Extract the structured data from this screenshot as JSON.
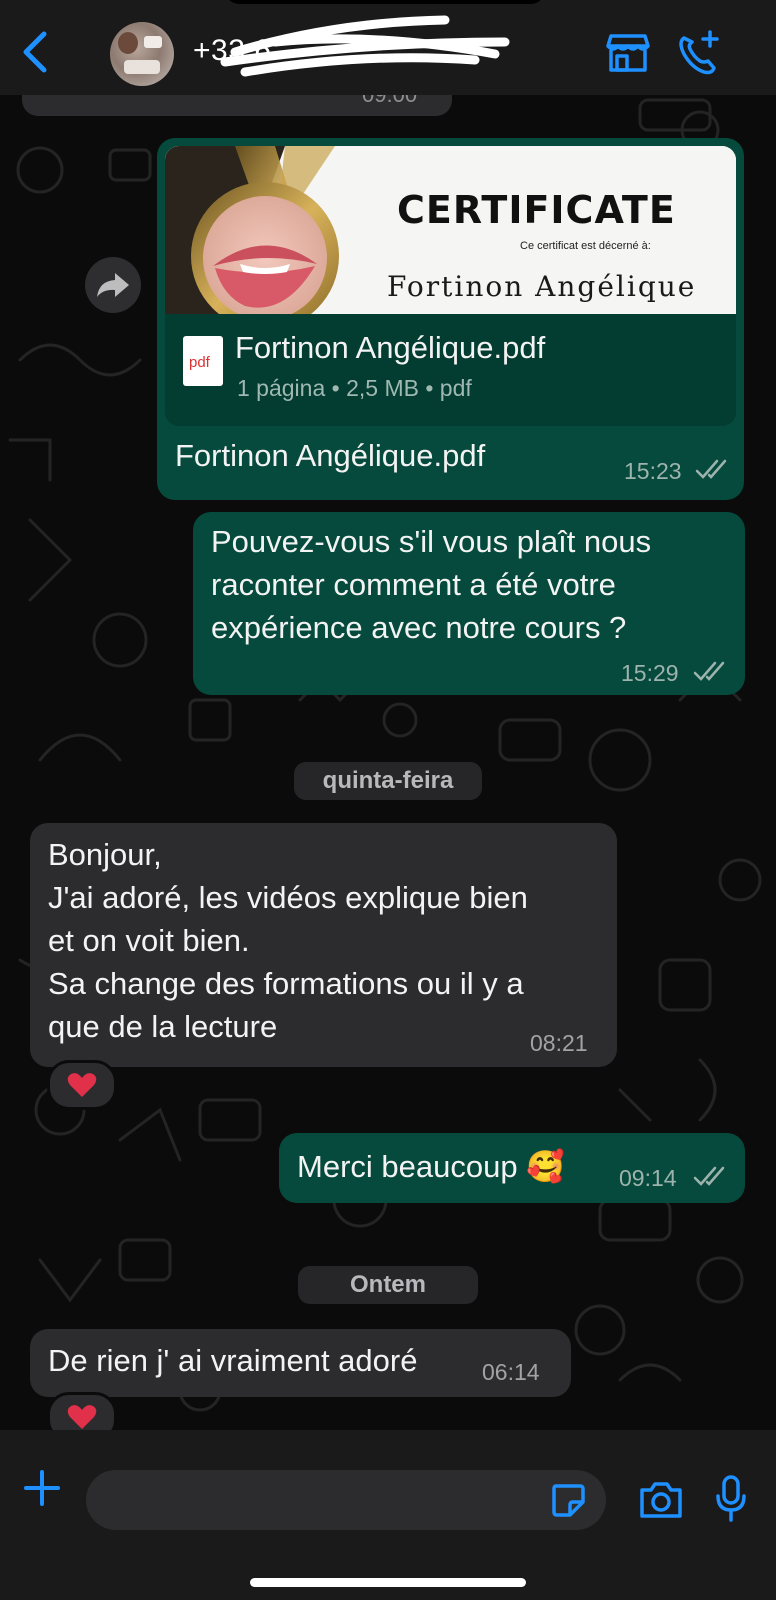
{
  "header": {
    "contact_name": "+33 6",
    "back_icon": "chevron-left-icon",
    "store_icon": "storefront-icon",
    "call_icon": "phone-plus-icon",
    "accent_color": "#1e90ff"
  },
  "top_partial_message": {
    "time": "09:00"
  },
  "file_message": {
    "preview": {
      "title": "CERTIFICATE",
      "subtitle": "Ce certificat est décerné à:",
      "recipient": "Fortinon Angélique"
    },
    "file_name": "Fortinon Angélique.pdf",
    "file_meta": "1 página • 2,5 MB • pdf",
    "file_type_label": "pdf",
    "caption": "Fortinon Angélique.pdf",
    "time": "15:23",
    "status": "read"
  },
  "question_message": {
    "lines": [
      "Pouvez-vous s'il vous plaît nous",
      "raconter comment a été votre",
      "expérience avec notre cours ?"
    ],
    "time": "15:29",
    "status": "read"
  },
  "date_separator_1": "quinta-feira",
  "reply_message": {
    "lines": [
      "Bonjour,",
      "J'ai adoré, les vidéos explique bien",
      "et on voit bien.",
      "Sa change des formations ou il y a",
      "que de la lecture"
    ],
    "time": "08:21",
    "reaction": "❤️"
  },
  "thanks_message": {
    "text": "Merci beaucoup 🥰",
    "time": "09:14",
    "status": "read"
  },
  "date_separator_2": "Ontem",
  "last_message": {
    "text": "De rien j' ai vraiment adoré",
    "time": "06:14",
    "reaction": "❤️"
  },
  "composer": {
    "placeholder": "",
    "plus_icon": "plus-icon",
    "sticker_icon": "sticker-icon",
    "camera_icon": "camera-icon",
    "mic_icon": "microphone-icon"
  },
  "colors": {
    "outgoing_bubble": "#054a3c",
    "incoming_bubble": "#2c2c2e",
    "background": "#0b0b0b"
  }
}
